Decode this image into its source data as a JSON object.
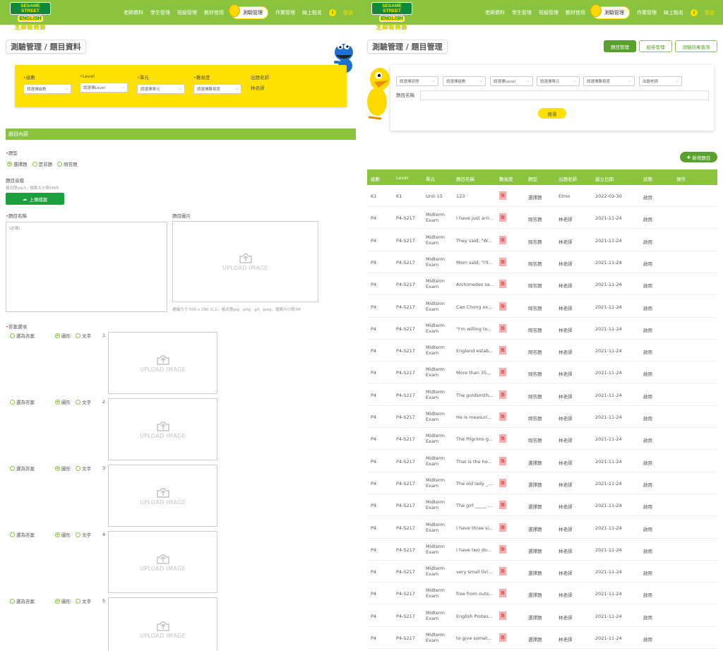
{
  "brand": {
    "line1": "SESAME STREET",
    "line2": "ENGLISH",
    "line3": "芝麻街美語"
  },
  "nav": {
    "items": [
      "老師資料",
      "學生管理",
      "班級管理",
      "教材使用",
      "測驗管理",
      "作業管理",
      "線上點名"
    ],
    "active": "測驗管理",
    "info": "i",
    "logout": "登出"
  },
  "left": {
    "title": "測驗管理 / 題目資料",
    "filters": {
      "grade_label": "級數",
      "grade_placeholder": "請選擇級數",
      "level_label": "Level",
      "level_placeholder": "請選擇Level",
      "unit_label": "單元",
      "unit_placeholder": "請選擇單元",
      "difficulty_label": "難易度",
      "difficulty_placeholder": "請選擇難易度",
      "teacher_label": "出題老師",
      "teacher_value": "林老師"
    },
    "section_title": "題目內容",
    "type_label": "題型",
    "type_options": [
      "選擇題",
      "是非題",
      "問答題"
    ],
    "audio_label": "題目音檔",
    "audio_hint": "格式限mp3，檔案大小限5M內",
    "upload_file": "上傳檔案",
    "name_label": "題目名稱",
    "name_placeholder": "(必填)",
    "image_label": "題目圖片",
    "upload_image": "UPLOAD IMAGE",
    "image_hint": "建議尺寸 500 x 280 以上，格式限jpg、png、gif、jpeg，檔案大小限3M",
    "answers_label": "答案選項",
    "answer_options": [
      {
        "num": "1",
        "correct": "選為答案",
        "graphic": "圖形",
        "text": "文字"
      },
      {
        "num": "2",
        "correct": "選為答案",
        "graphic": "圖形",
        "text": "文字"
      },
      {
        "num": "3",
        "correct": "選為答案",
        "graphic": "圖形",
        "text": "文字"
      },
      {
        "num": "4",
        "correct": "選為答案",
        "graphic": "圖形",
        "text": "文字"
      },
      {
        "num": "5",
        "correct": "選為答案",
        "graphic": "圖形",
        "text": "文字"
      }
    ]
  },
  "right": {
    "title": "測驗管理 / 題目管理",
    "tabs": [
      "題目管理",
      "組卷管理",
      "測驗結果查詢"
    ],
    "search": {
      "selects": [
        "請選擇狀態",
        "請選擇級數",
        "請選擇Level",
        "請選擇單元",
        "請選擇難易度",
        "出題老師"
      ],
      "name_label": "題目名稱",
      "button": "搜尋"
    },
    "add_button": "新增題目",
    "columns": [
      "級數",
      "Level",
      "單元",
      "題目名稱",
      "難易度",
      "題型",
      "出題老師",
      "建立日期",
      "狀態",
      "操作"
    ],
    "rows": [
      [
        "K1",
        "K1",
        "Unit-15",
        "123",
        "難",
        "選擇題",
        "Elmo",
        "2022-03-30",
        "啟用"
      ],
      [
        "P4",
        "P4-S217",
        "Midterm Exam",
        "I have just arri...",
        "難",
        "問答題",
        "林老師",
        "2021-11-24",
        "啟用"
      ],
      [
        "P4",
        "P4-S217",
        "Midterm Exam",
        "They said, \"W...",
        "難",
        "問答題",
        "林老師",
        "2021-11-24",
        "啟用"
      ],
      [
        "P4",
        "P4-S217",
        "Midterm Exam",
        "Mom said, \"I'll...",
        "難",
        "問答題",
        "林老師",
        "2021-11-24",
        "啟用"
      ],
      [
        "P4",
        "P4-S217",
        "Midterm Exam",
        "Archimedes sa...",
        "難",
        "問答題",
        "林老師",
        "2021-11-24",
        "啟用"
      ],
      [
        "P4",
        "P4-S217",
        "Midterm Exam",
        "Cao Chong ex...",
        "難",
        "問答題",
        "林老師",
        "2021-11-24",
        "啟用"
      ],
      [
        "P4",
        "P4-S217",
        "Midterm Exam",
        "\"I'm willing to...",
        "難",
        "問答題",
        "林老師",
        "2021-11-24",
        "啟用"
      ],
      [
        "P4",
        "P4-S217",
        "Midterm Exam",
        "England estab...",
        "難",
        "問答題",
        "林老師",
        "2021-11-24",
        "啟用"
      ],
      [
        "P4",
        "P4-S217",
        "Midterm Exam",
        "More than 35...",
        "難",
        "問答題",
        "林老師",
        "2021-11-24",
        "啟用"
      ],
      [
        "P4",
        "P4-S217",
        "Midterm Exam",
        "The goldsmith...",
        "難",
        "問答題",
        "林老師",
        "2021-11-24",
        "啟用"
      ],
      [
        "P4",
        "P4-S217",
        "Midterm Exam",
        "He is measuri...",
        "難",
        "問答題",
        "林老師",
        "2021-11-24",
        "啟用"
      ],
      [
        "P4",
        "P4-S217",
        "Midterm Exam",
        "The Pilgrims g...",
        "難",
        "問答題",
        "林老師",
        "2021-11-24",
        "啟用"
      ],
      [
        "P4",
        "P4-S217",
        "Midterm Exam",
        "That is the ho...",
        "難",
        "選擇題",
        "林老師",
        "2021-11-24",
        "啟用"
      ],
      [
        "P4",
        "P4-S217",
        "Midterm Exam",
        "The old lady _...",
        "難",
        "選擇題",
        "林老師",
        "2021-11-24",
        "啟用"
      ],
      [
        "P4",
        "P4-S217",
        "Midterm Exam",
        "The girl _____ ...",
        "難",
        "選擇題",
        "林老師",
        "2021-11-24",
        "啟用"
      ],
      [
        "P4",
        "P4-S217",
        "Midterm Exam",
        "I have three si...",
        "難",
        "選擇題",
        "林老師",
        "2021-11-24",
        "啟用"
      ],
      [
        "P4",
        "P4-S217",
        "Midterm Exam",
        "I have two do...",
        "難",
        "選擇題",
        "林老師",
        "2021-11-24",
        "啟用"
      ],
      [
        "P4",
        "P4-S217",
        "Midterm Exam",
        "very small livi...",
        "難",
        "選擇題",
        "林老師",
        "2021-11-24",
        "啟用"
      ],
      [
        "P4",
        "P4-S217",
        "Midterm Exam",
        "free from outs...",
        "難",
        "選擇題",
        "林老師",
        "2021-11-24",
        "啟用"
      ],
      [
        "P4",
        "P4-S217",
        "Midterm Exam",
        "English Protes...",
        "難",
        "選擇題",
        "林老師",
        "2021-11-24",
        "啟用"
      ],
      [
        "P4",
        "P4-S217",
        "Midterm Exam",
        "to give somet...",
        "難",
        "選擇題",
        "林老師",
        "2021-11-24",
        "啟用"
      ]
    ],
    "partial_row_unit": "Midterm"
  },
  "colors": {
    "header_green": "#8ac43f",
    "dark_green": "#5aa02c",
    "yellow": "#ffe100",
    "badge_red": "#f4b0b0"
  }
}
